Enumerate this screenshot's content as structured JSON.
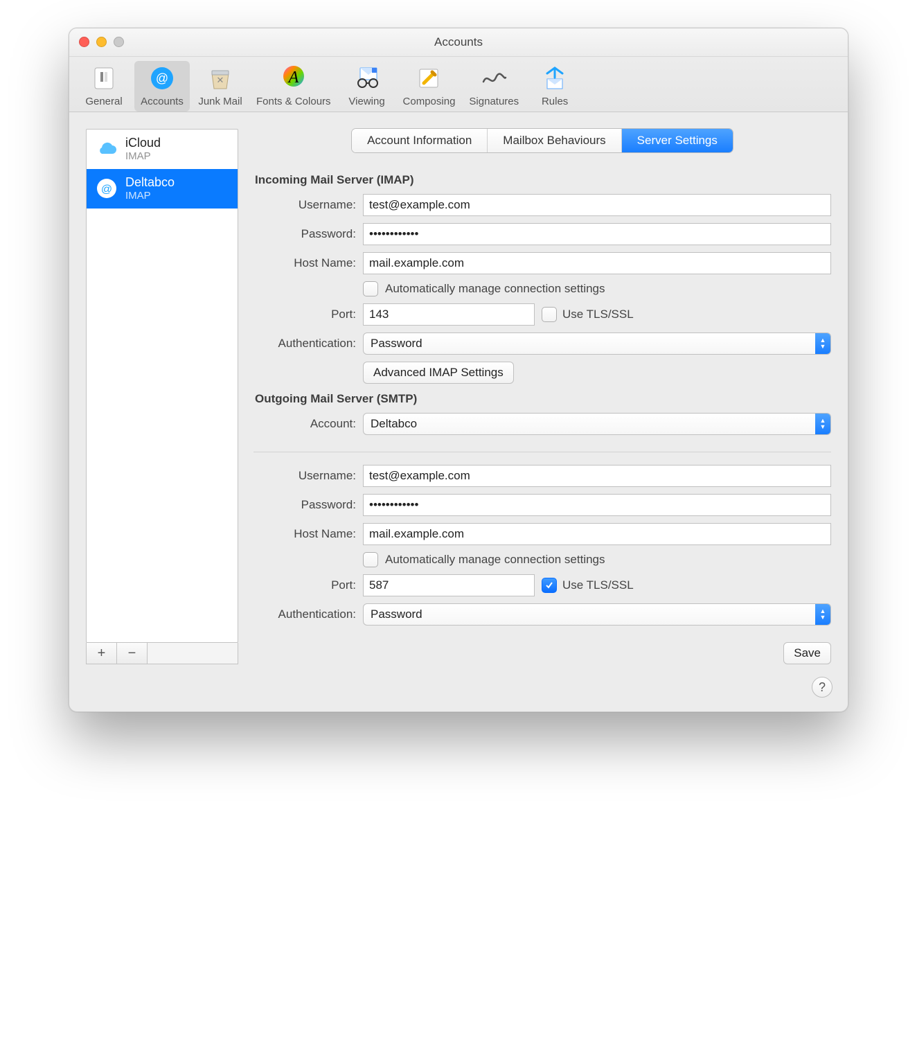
{
  "window": {
    "title": "Accounts"
  },
  "toolbar": {
    "items": [
      {
        "label": "General"
      },
      {
        "label": "Accounts"
      },
      {
        "label": "Junk Mail"
      },
      {
        "label": "Fonts & Colours"
      },
      {
        "label": "Viewing"
      },
      {
        "label": "Composing"
      },
      {
        "label": "Signatures"
      },
      {
        "label": "Rules"
      }
    ],
    "active_index": 1
  },
  "sidebar": {
    "accounts": [
      {
        "name": "iCloud",
        "protocol": "IMAP"
      },
      {
        "name": "Deltabco",
        "protocol": "IMAP"
      }
    ],
    "selected_index": 1,
    "add_label": "+",
    "remove_label": "−"
  },
  "tabs": {
    "items": [
      "Account Information",
      "Mailbox Behaviours",
      "Server Settings"
    ],
    "active_index": 2
  },
  "sections": {
    "incoming_title": "Incoming Mail Server (IMAP)",
    "outgoing_title": "Outgoing Mail Server (SMTP)"
  },
  "labels": {
    "username": "Username:",
    "password": "Password:",
    "hostname": "Host Name:",
    "port": "Port:",
    "authentication": "Authentication:",
    "account": "Account:",
    "auto_manage": "Automatically manage connection settings",
    "use_tls": "Use TLS/SSL",
    "advanced_imap": "Advanced IMAP Settings",
    "save": "Save"
  },
  "incoming": {
    "username": "test@example.com",
    "password": "••••••••••••",
    "hostname": "mail.example.com",
    "auto_manage": false,
    "port": "143",
    "use_tls": false,
    "authentication": "Password"
  },
  "outgoing": {
    "account": "Deltabco",
    "username": "test@example.com",
    "password": "••••••••••••",
    "hostname": "mail.example.com",
    "auto_manage": false,
    "port": "587",
    "use_tls": true,
    "authentication": "Password"
  },
  "help_label": "?"
}
